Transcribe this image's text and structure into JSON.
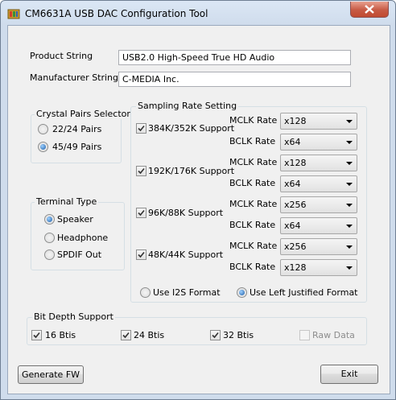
{
  "window": {
    "title": "CM6631A USB DAC Configuration Tool"
  },
  "product": {
    "label": "Product String",
    "value": "USB2.0 High-Speed True HD Audio"
  },
  "manufacturer": {
    "label": "Manufacturer String",
    "value": "C-MEDIA Inc."
  },
  "crystal": {
    "title": "Crystal Pairs Selector",
    "options": [
      "22/24 Pairs",
      "45/49 Pairs"
    ],
    "selected": "45/49 Pairs"
  },
  "terminal": {
    "title": "Terminal Type",
    "options": [
      "Speaker",
      "Headphone",
      "SPDIF Out"
    ],
    "selected": "Speaker"
  },
  "sampling": {
    "title": "Sampling Rate Setting",
    "mclk_label": "MCLK Rate",
    "bclk_label": "BCLK Rate",
    "rows": [
      {
        "label": "384K/352K Support",
        "checked": true,
        "mclk": "x128",
        "bclk": "x64"
      },
      {
        "label": "192K/176K Support",
        "checked": true,
        "mclk": "x128",
        "bclk": "x64"
      },
      {
        "label": "96K/88K Support",
        "checked": true,
        "mclk": "x256",
        "bclk": "x64"
      },
      {
        "label": "48K/44K Support",
        "checked": true,
        "mclk": "x256",
        "bclk": "x128"
      }
    ],
    "formats": [
      "Use I2S Format",
      "Use Left Justified Format"
    ],
    "format_selected": "Use Left Justified Format"
  },
  "bitdepth": {
    "title": "Bit Depth Support",
    "items": [
      {
        "label": "16 Btis",
        "checked": true,
        "enabled": true
      },
      {
        "label": "24 Btis",
        "checked": true,
        "enabled": true
      },
      {
        "label": "32 Btis",
        "checked": true,
        "enabled": true
      },
      {
        "label": "Raw Data",
        "checked": false,
        "enabled": false
      }
    ]
  },
  "buttons": {
    "generate": "Generate FW",
    "exit": "Exit"
  }
}
